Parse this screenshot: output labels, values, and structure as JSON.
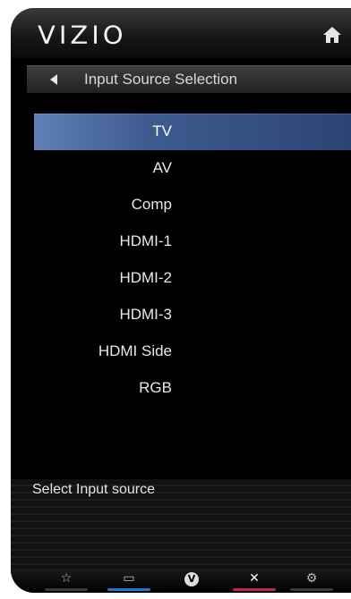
{
  "header": {
    "brand": "VIZIO",
    "home_icon": "home-icon"
  },
  "menu": {
    "title": "Input Source Selection",
    "back_icon": "left-triangle-icon"
  },
  "inputs": [
    {
      "label": "TV",
      "selected": true
    },
    {
      "label": "AV",
      "selected": false
    },
    {
      "label": "Comp",
      "selected": false
    },
    {
      "label": "HDMI-1",
      "selected": false
    },
    {
      "label": "HDMI-2",
      "selected": false
    },
    {
      "label": "HDMI-3",
      "selected": false
    },
    {
      "label": "HDMI Side",
      "selected": false
    },
    {
      "label": "RGB",
      "selected": false
    }
  ],
  "status": {
    "text": "Select Input source"
  },
  "bottom_bar": [
    {
      "icon": "star-icon",
      "glyph": "☆",
      "color": "#3a3a3a"
    },
    {
      "icon": "picture-icon",
      "glyph": "▭",
      "color": "#1f78d1"
    },
    {
      "icon": "vizio-v-icon",
      "glyph": "V",
      "color": "#000000"
    },
    {
      "icon": "close-icon",
      "glyph": "✕",
      "color": "#c4225a"
    },
    {
      "icon": "gear-icon",
      "glyph": "⚙",
      "color": "#3a3a3a"
    }
  ],
  "colors": {
    "selection": "#3e5c90"
  }
}
